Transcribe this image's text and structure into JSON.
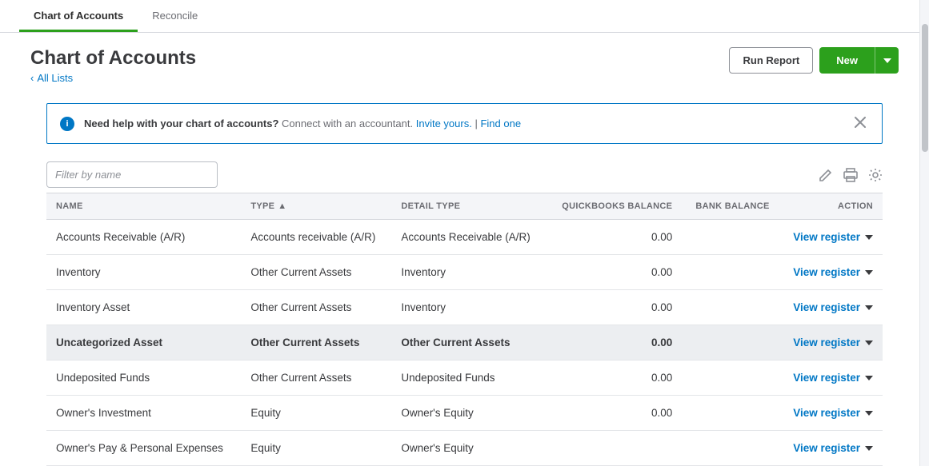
{
  "tabs": {
    "chart": "Chart of Accounts",
    "reconcile": "Reconcile"
  },
  "page": {
    "title": "Chart of Accounts",
    "breadcrumb": "All Lists"
  },
  "buttons": {
    "run_report": "Run Report",
    "new": "New"
  },
  "notice": {
    "strong": "Need help with your chart of accounts?",
    "muted": "Connect with an accountant.",
    "link1": "Invite yours.",
    "sep": " | ",
    "link2": "Find one"
  },
  "filter": {
    "placeholder": "Filter by name"
  },
  "columns": {
    "name": "NAME",
    "type": "TYPE",
    "detail": "DETAIL TYPE",
    "qb_bal": "QUICKBOOKS BALANCE",
    "bank_bal": "BANK BALANCE",
    "action": "ACTION"
  },
  "action_label": "View register",
  "rows": [
    {
      "name": "Accounts Receivable (A/R)",
      "type": "Accounts receivable (A/R)",
      "detail": "Accounts Receivable (A/R)",
      "qb": "0.00",
      "bank": "",
      "highlight": false
    },
    {
      "name": "Inventory",
      "type": "Other Current Assets",
      "detail": "Inventory",
      "qb": "0.00",
      "bank": "",
      "highlight": false
    },
    {
      "name": "Inventory Asset",
      "type": "Other Current Assets",
      "detail": "Inventory",
      "qb": "0.00",
      "bank": "",
      "highlight": false
    },
    {
      "name": "Uncategorized Asset",
      "type": "Other Current Assets",
      "detail": "Other Current Assets",
      "qb": "0.00",
      "bank": "",
      "highlight": true
    },
    {
      "name": "Undeposited Funds",
      "type": "Other Current Assets",
      "detail": "Undeposited Funds",
      "qb": "0.00",
      "bank": "",
      "highlight": false
    },
    {
      "name": "Owner's Investment",
      "type": "Equity",
      "detail": "Owner's Equity",
      "qb": "0.00",
      "bank": "",
      "highlight": false
    },
    {
      "name": "Owner's Pay & Personal Expenses",
      "type": "Equity",
      "detail": "Owner's Equity",
      "qb": "",
      "bank": "",
      "highlight": false
    }
  ]
}
